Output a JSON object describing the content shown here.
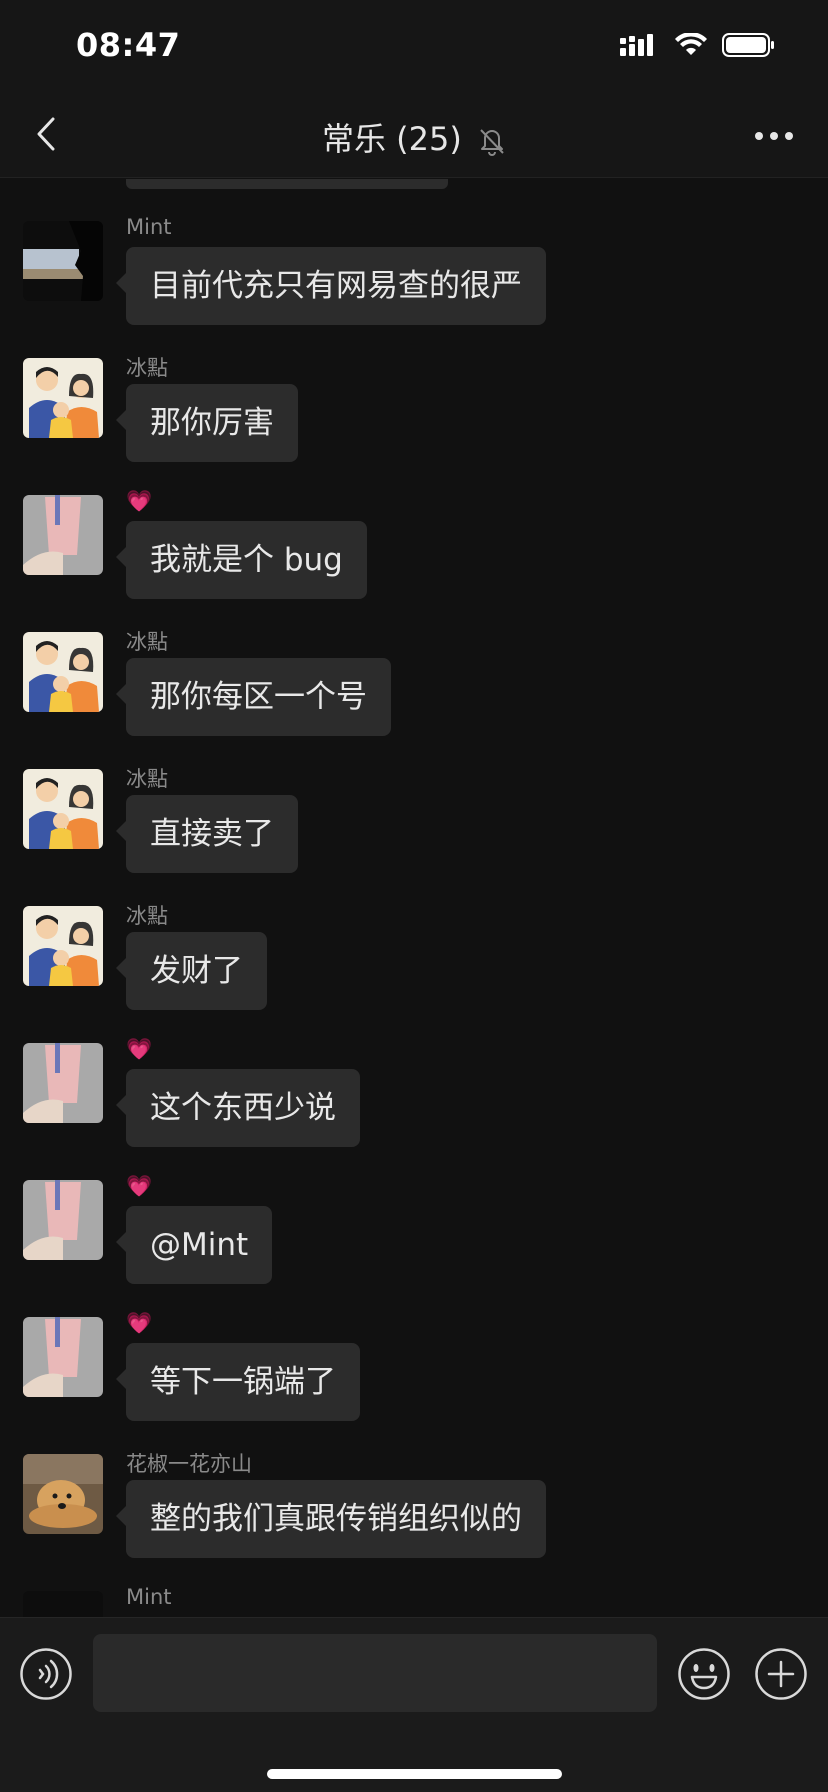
{
  "status_bar": {
    "time": "08:47"
  },
  "nav": {
    "title": "常乐 (25)"
  },
  "messages": [
    {
      "sender": "Mint",
      "text": "目前代充只有网易查的很严",
      "avatar": "mint-avatar"
    },
    {
      "sender": "冰點",
      "text": "那你厉害",
      "avatar": "family-avatar"
    },
    {
      "sender": "💗",
      "text": "我就是个 bug",
      "avatar": "drink-avatar"
    },
    {
      "sender": "冰點",
      "text": "那你每区一个号",
      "avatar": "family-avatar"
    },
    {
      "sender": "冰點",
      "text": "直接卖了",
      "avatar": "family-avatar"
    },
    {
      "sender": "冰點",
      "text": "发财了",
      "avatar": "family-avatar"
    },
    {
      "sender": "💗",
      "text": "这个东西少说",
      "avatar": "drink-avatar"
    },
    {
      "sender": "💗",
      "text": "@Mint",
      "avatar": "drink-avatar"
    },
    {
      "sender": "💗",
      "text": "等下一锅端了",
      "avatar": "drink-avatar"
    },
    {
      "sender": "花椒一花亦山",
      "text": "整的我们真跟传销组织似的",
      "avatar": "dog-avatar"
    },
    {
      "sender": "Mint",
      "text": "",
      "avatar": "mint-avatar"
    }
  ],
  "input": {
    "value": "",
    "placeholder": ""
  },
  "colors": {
    "background": "#111111",
    "bubble": "#2c2c2c",
    "bar": "#161616"
  }
}
